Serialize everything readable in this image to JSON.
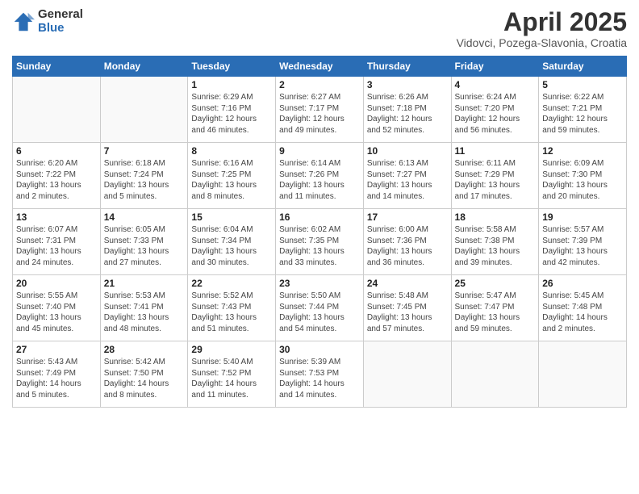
{
  "header": {
    "logo_general": "General",
    "logo_blue": "Blue",
    "month_title": "April 2025",
    "location": "Vidovci, Pozega-Slavonia, Croatia"
  },
  "weekdays": [
    "Sunday",
    "Monday",
    "Tuesday",
    "Wednesday",
    "Thursday",
    "Friday",
    "Saturday"
  ],
  "weeks": [
    [
      {
        "day": "",
        "info": ""
      },
      {
        "day": "",
        "info": ""
      },
      {
        "day": "1",
        "info": "Sunrise: 6:29 AM\nSunset: 7:16 PM\nDaylight: 12 hours\nand 46 minutes."
      },
      {
        "day": "2",
        "info": "Sunrise: 6:27 AM\nSunset: 7:17 PM\nDaylight: 12 hours\nand 49 minutes."
      },
      {
        "day": "3",
        "info": "Sunrise: 6:26 AM\nSunset: 7:18 PM\nDaylight: 12 hours\nand 52 minutes."
      },
      {
        "day": "4",
        "info": "Sunrise: 6:24 AM\nSunset: 7:20 PM\nDaylight: 12 hours\nand 56 minutes."
      },
      {
        "day": "5",
        "info": "Sunrise: 6:22 AM\nSunset: 7:21 PM\nDaylight: 12 hours\nand 59 minutes."
      }
    ],
    [
      {
        "day": "6",
        "info": "Sunrise: 6:20 AM\nSunset: 7:22 PM\nDaylight: 13 hours\nand 2 minutes."
      },
      {
        "day": "7",
        "info": "Sunrise: 6:18 AM\nSunset: 7:24 PM\nDaylight: 13 hours\nand 5 minutes."
      },
      {
        "day": "8",
        "info": "Sunrise: 6:16 AM\nSunset: 7:25 PM\nDaylight: 13 hours\nand 8 minutes."
      },
      {
        "day": "9",
        "info": "Sunrise: 6:14 AM\nSunset: 7:26 PM\nDaylight: 13 hours\nand 11 minutes."
      },
      {
        "day": "10",
        "info": "Sunrise: 6:13 AM\nSunset: 7:27 PM\nDaylight: 13 hours\nand 14 minutes."
      },
      {
        "day": "11",
        "info": "Sunrise: 6:11 AM\nSunset: 7:29 PM\nDaylight: 13 hours\nand 17 minutes."
      },
      {
        "day": "12",
        "info": "Sunrise: 6:09 AM\nSunset: 7:30 PM\nDaylight: 13 hours\nand 20 minutes."
      }
    ],
    [
      {
        "day": "13",
        "info": "Sunrise: 6:07 AM\nSunset: 7:31 PM\nDaylight: 13 hours\nand 24 minutes."
      },
      {
        "day": "14",
        "info": "Sunrise: 6:05 AM\nSunset: 7:33 PM\nDaylight: 13 hours\nand 27 minutes."
      },
      {
        "day": "15",
        "info": "Sunrise: 6:04 AM\nSunset: 7:34 PM\nDaylight: 13 hours\nand 30 minutes."
      },
      {
        "day": "16",
        "info": "Sunrise: 6:02 AM\nSunset: 7:35 PM\nDaylight: 13 hours\nand 33 minutes."
      },
      {
        "day": "17",
        "info": "Sunrise: 6:00 AM\nSunset: 7:36 PM\nDaylight: 13 hours\nand 36 minutes."
      },
      {
        "day": "18",
        "info": "Sunrise: 5:58 AM\nSunset: 7:38 PM\nDaylight: 13 hours\nand 39 minutes."
      },
      {
        "day": "19",
        "info": "Sunrise: 5:57 AM\nSunset: 7:39 PM\nDaylight: 13 hours\nand 42 minutes."
      }
    ],
    [
      {
        "day": "20",
        "info": "Sunrise: 5:55 AM\nSunset: 7:40 PM\nDaylight: 13 hours\nand 45 minutes."
      },
      {
        "day": "21",
        "info": "Sunrise: 5:53 AM\nSunset: 7:41 PM\nDaylight: 13 hours\nand 48 minutes."
      },
      {
        "day": "22",
        "info": "Sunrise: 5:52 AM\nSunset: 7:43 PM\nDaylight: 13 hours\nand 51 minutes."
      },
      {
        "day": "23",
        "info": "Sunrise: 5:50 AM\nSunset: 7:44 PM\nDaylight: 13 hours\nand 54 minutes."
      },
      {
        "day": "24",
        "info": "Sunrise: 5:48 AM\nSunset: 7:45 PM\nDaylight: 13 hours\nand 57 minutes."
      },
      {
        "day": "25",
        "info": "Sunrise: 5:47 AM\nSunset: 7:47 PM\nDaylight: 13 hours\nand 59 minutes."
      },
      {
        "day": "26",
        "info": "Sunrise: 5:45 AM\nSunset: 7:48 PM\nDaylight: 14 hours\nand 2 minutes."
      }
    ],
    [
      {
        "day": "27",
        "info": "Sunrise: 5:43 AM\nSunset: 7:49 PM\nDaylight: 14 hours\nand 5 minutes."
      },
      {
        "day": "28",
        "info": "Sunrise: 5:42 AM\nSunset: 7:50 PM\nDaylight: 14 hours\nand 8 minutes."
      },
      {
        "day": "29",
        "info": "Sunrise: 5:40 AM\nSunset: 7:52 PM\nDaylight: 14 hours\nand 11 minutes."
      },
      {
        "day": "30",
        "info": "Sunrise: 5:39 AM\nSunset: 7:53 PM\nDaylight: 14 hours\nand 14 minutes."
      },
      {
        "day": "",
        "info": ""
      },
      {
        "day": "",
        "info": ""
      },
      {
        "day": "",
        "info": ""
      }
    ]
  ]
}
